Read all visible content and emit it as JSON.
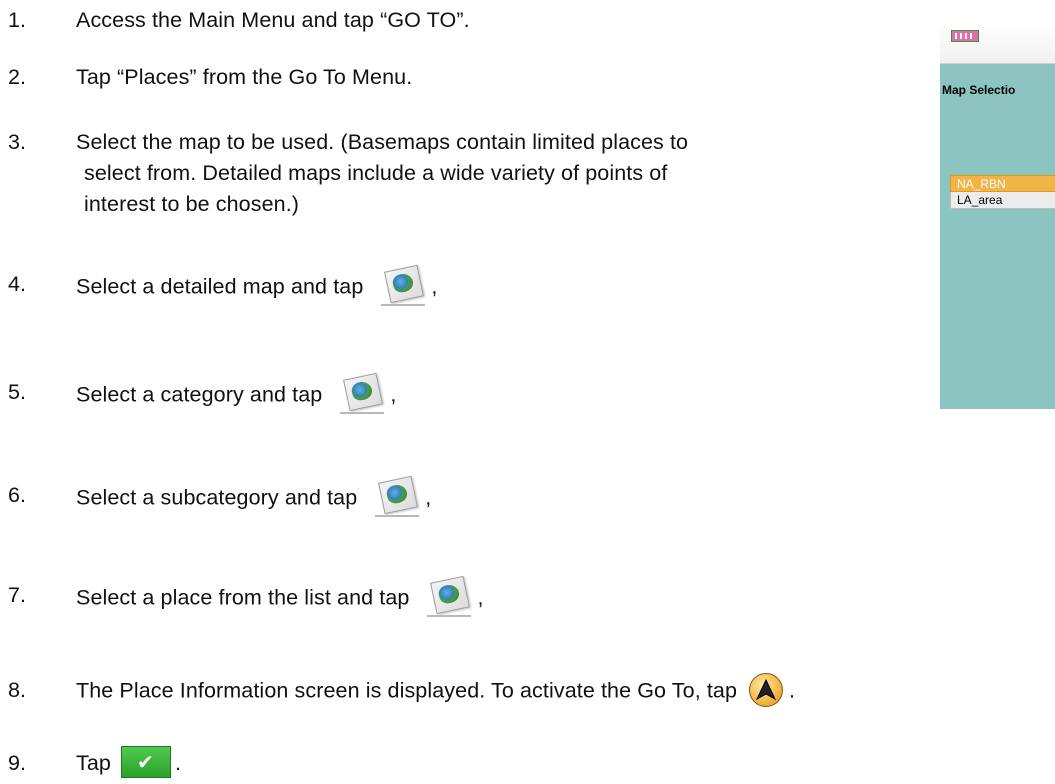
{
  "steps": [
    {
      "num": "1.",
      "text": "Access the Main Menu and tap “GO TO”."
    },
    {
      "num": "2.",
      "text": "Tap “Places” from the Go To Menu."
    },
    {
      "num": "3.",
      "text": "Select the map to be used.  (Basemaps contain limited places to",
      "line2": "select from. Detailed maps include a wide variety of points of",
      "line3": "interest to be chosen.)"
    },
    {
      "num": "4.",
      "text": "Select a detailed map and tap",
      "suffix": ","
    },
    {
      "num": "5.",
      "text": "Select a category and tap",
      "suffix": ","
    },
    {
      "num": "6.",
      "text": "Select a subcategory and tap",
      "suffix": ","
    },
    {
      "num": "7.",
      "text": "Select a place from the list and tap",
      "suffix": ","
    },
    {
      "num": "8.",
      "text": "The Place Information screen is displayed. To activate the Go To, tap",
      "suffix": "."
    },
    {
      "num": "9.",
      "text": "Tap",
      "suffix": "."
    }
  ],
  "device": {
    "screen_title": "Map Selectio",
    "list_items": [
      "NA_RBN",
      "LA_area"
    ],
    "colors": {
      "background": "#8cc4c2",
      "selected": "#f3b446"
    }
  },
  "icons": {
    "map_icon": "map-icon",
    "goto_icon": "goto-arrow-icon",
    "ok_icon": "checkmark-icon"
  }
}
